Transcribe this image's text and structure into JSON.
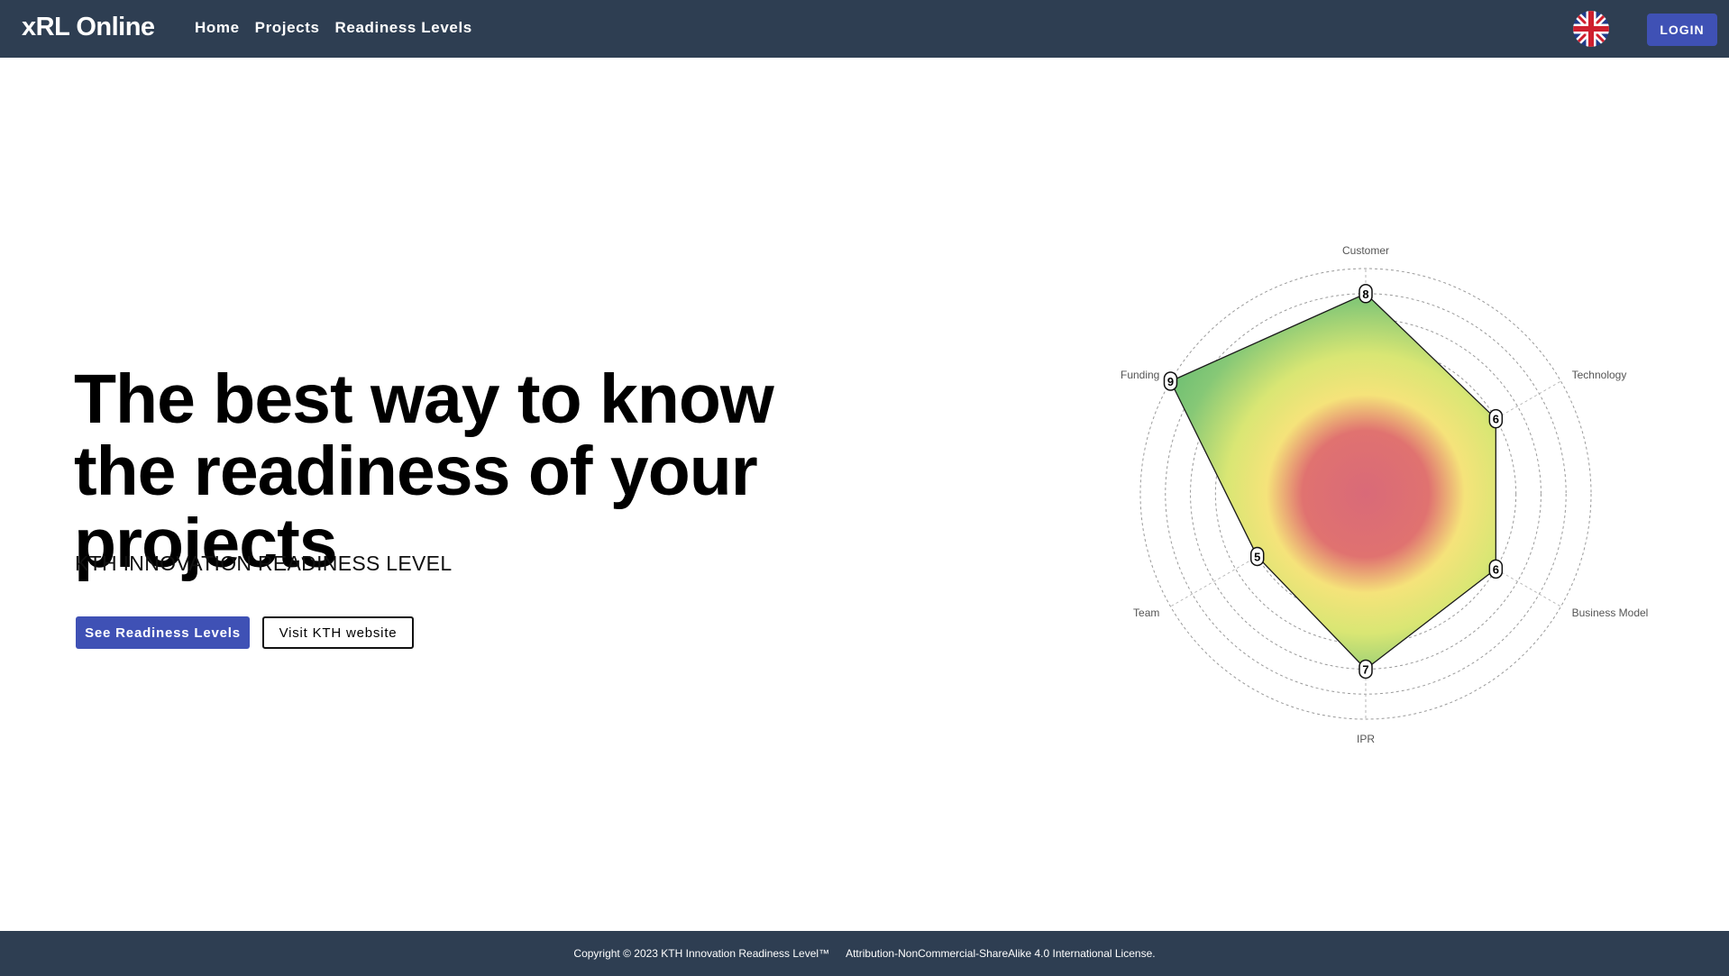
{
  "app": {
    "brand": "xRL Online"
  },
  "nav": {
    "items": [
      "Home",
      "Projects",
      "Readiness Levels"
    ]
  },
  "header": {
    "login_label": "LOGIN",
    "language_icon": "uk-flag-icon"
  },
  "hero": {
    "title": "The best way to know the readiness of your projects",
    "subtitle": "KTH INNOVATION READINESS LEVEL",
    "primary_button": "See Readiness Levels",
    "secondary_button": "Visit KTH website"
  },
  "chart_data": {
    "type": "radar",
    "axes": [
      "Customer",
      "Technology",
      "Business Model",
      "IPR",
      "Team",
      "Funding"
    ],
    "values": [
      8,
      6,
      6,
      7,
      5,
      9
    ],
    "max": 9,
    "rings": 9,
    "fill": "gradient red-center to green-edge"
  },
  "footer": {
    "copyright": "Copyright © 2023 KTH Innovation Readiness Level™",
    "license": "Attribution-NonCommercial-ShareAlike 4.0 International License."
  },
  "colors": {
    "header_bg": "#2e3e52",
    "accent": "#3f51b5"
  }
}
